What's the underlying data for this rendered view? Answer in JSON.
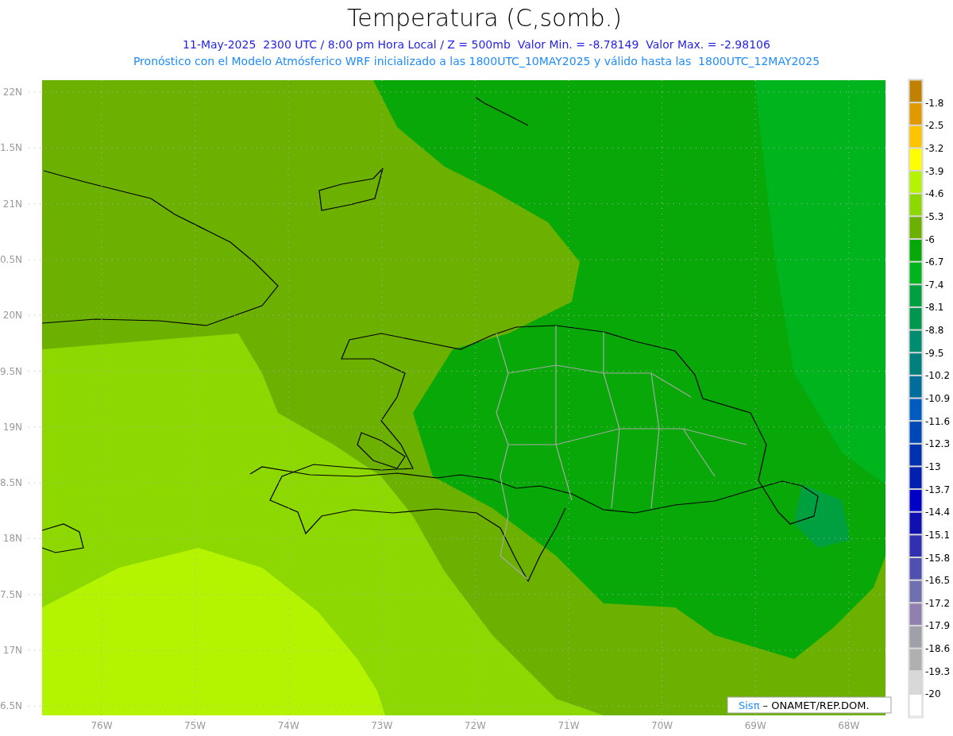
{
  "title": "Temperatura (C,somb.)",
  "subtitle_lines": [
    "11-May-2025  2300 UTC / 8:00 pm Hora Local / Z = 500mb  Valor Min. = -8.78149  Valor Max. = -2.98106",
    "Pronóstico con el Modelo Atmósferico WRF inicializado a las 1800UTC_10MAY2025 y válido hasta las  1800UTC_12MAY2025"
  ],
  "latitude_labels": [
    "22N",
    "1.5N",
    "21N",
    "0.5N",
    "20N",
    "9.5N",
    "19N",
    "8.5N",
    "18N",
    "7.5N",
    "17N",
    "6.5N"
  ],
  "longitude_labels": [
    "76W",
    "75W",
    "74W",
    "73W",
    "72W",
    "71W",
    "70W",
    "69W",
    "68W"
  ],
  "color_scale": [
    {
      "color": "#c08000",
      "label": "-1.8"
    },
    {
      "color": "#e09a00",
      "label": "-2.5"
    },
    {
      "color": "#ffc400",
      "label": "-3.2"
    },
    {
      "color": "#ffff00",
      "label": "-3.9"
    },
    {
      "color": "#b4f400",
      "label": "-4.6"
    },
    {
      "color": "#8cd800",
      "label": "-5.3"
    },
    {
      "color": "#6cb000",
      "label": "-6"
    },
    {
      "color": "#08a808",
      "label": "-6.7"
    },
    {
      "color": "#00b41e",
      "label": "-7.4"
    },
    {
      "color": "#00a040",
      "label": "-8.1"
    },
    {
      "color": "#009650",
      "label": "-8.8"
    },
    {
      "color": "#008c6e",
      "label": "-9.5"
    },
    {
      "color": "#00807c",
      "label": "-10.2"
    },
    {
      "color": "#006e9a",
      "label": "-10.9"
    },
    {
      "color": "#005cbe",
      "label": "-11.6"
    },
    {
      "color": "#0048b8",
      "label": "-12.3"
    },
    {
      "color": "#0032b0",
      "label": "-13"
    },
    {
      "color": "#0020b0",
      "label": "-13.7"
    },
    {
      "color": "#0000c8",
      "label": "-14.4"
    },
    {
      "color": "#1010b0",
      "label": "-15.1"
    },
    {
      "color": "#3030b0",
      "label": "-15.8"
    },
    {
      "color": "#5050b0",
      "label": "-16.5"
    },
    {
      "color": "#7070b0",
      "label": "-17.2"
    },
    {
      "color": "#9080b0",
      "label": "-17.9"
    },
    {
      "color": "#a0a0a8",
      "label": "-18.6"
    },
    {
      "color": "#b0b0b0",
      "label": "-19.3"
    },
    {
      "color": "#d8d8d8",
      "label": "-20"
    },
    {
      "color": "#ffffff"
    }
  ],
  "credit": {
    "brand": "Sisπ",
    "text": "– ONAMET/REP.DOM."
  }
}
